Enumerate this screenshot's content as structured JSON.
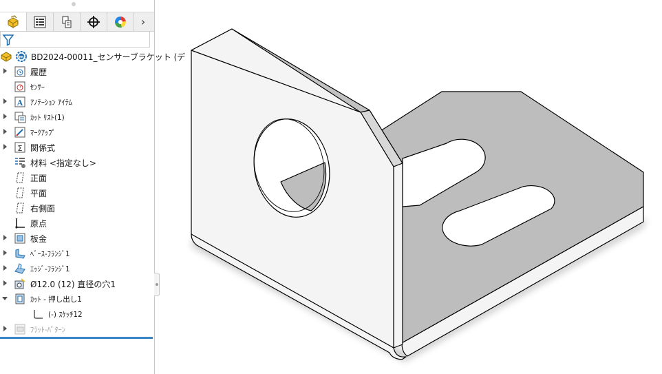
{
  "feature_manager": {
    "tabs": [
      {
        "name": "featuremanager-tab",
        "icon": "featuremanager-icon",
        "active": true
      },
      {
        "name": "propertymanager-tab",
        "icon": "property-list-icon",
        "active": false
      },
      {
        "name": "configurationmanager-tab",
        "icon": "configuration-icon",
        "active": false
      },
      {
        "name": "dimxpert-tab",
        "icon": "crosshair-icon",
        "active": false
      },
      {
        "name": "display-manager-tab",
        "icon": "appearance-pie-icon",
        "active": false
      }
    ],
    "more_tabs_glyph": "›",
    "filter_icon": "filter-funnel-icon",
    "tree": {
      "root": "BD2024-00011_センサーブラケット (デ",
      "items": [
        {
          "label": "履歴",
          "icon": "history-icon",
          "expandable": true
        },
        {
          "label": "ｾﾝｻｰ",
          "icon": "sensor-icon",
          "expandable": false
        },
        {
          "label": "ｱﾉﾃｰｼｮﾝ ｱｲﾃﾑ",
          "icon": "annotation-icon",
          "expandable": true
        },
        {
          "label": "ｶｯﾄ ﾘｽﾄ(1)",
          "icon": "cut-list-icon",
          "expandable": true
        },
        {
          "label": "ﾏｰｸｱｯﾌﾟ",
          "icon": "markup-icon",
          "expandable": true
        },
        {
          "label": "関係式",
          "icon": "equations-icon",
          "expandable": true
        },
        {
          "label": "材料 <指定なし>",
          "icon": "material-icon",
          "expandable": false
        },
        {
          "label": "正面",
          "icon": "plane-icon",
          "expandable": false
        },
        {
          "label": "平面",
          "icon": "plane-icon",
          "expandable": false
        },
        {
          "label": "右側面",
          "icon": "plane-icon",
          "expandable": false
        },
        {
          "label": "原点",
          "icon": "origin-icon",
          "expandable": false
        },
        {
          "label": "板金",
          "icon": "sheet-metal-icon",
          "expandable": true
        },
        {
          "label": "ﾍﾞｰｽ-ﾌﾗﾝｼﾞ1",
          "icon": "base-flange-icon",
          "expandable": true
        },
        {
          "label": "ｴｯｼﾞ-ﾌﾗﾝｼﾞ1",
          "icon": "edge-flange-icon",
          "expandable": true
        },
        {
          "label": "Ø12.0 (12) 直径の穴1",
          "icon": "hole-wizard-icon",
          "expandable": true
        },
        {
          "label": "ｶｯﾄ - 押し出し1",
          "icon": "cut-extrude-icon",
          "expandable": true,
          "expanded": true
        },
        {
          "label": "(-) ｽｹｯﾁ12",
          "icon": "sketch-icon",
          "expandable": false,
          "child": true
        },
        {
          "label": "ﾌﾗｯﾄ-ﾊﾟﾀｰﾝ",
          "icon": "flat-pattern-icon",
          "expandable": true,
          "suppressed": true
        }
      ]
    }
  },
  "model": {
    "description": "L-shaped sheet metal sensor bracket",
    "face_color": "#f4f4f4",
    "shaded_color": "#bdbdbd",
    "edge_color": "#000000",
    "features": [
      "round-hole",
      "slot-1",
      "slot-2",
      "bend"
    ]
  }
}
